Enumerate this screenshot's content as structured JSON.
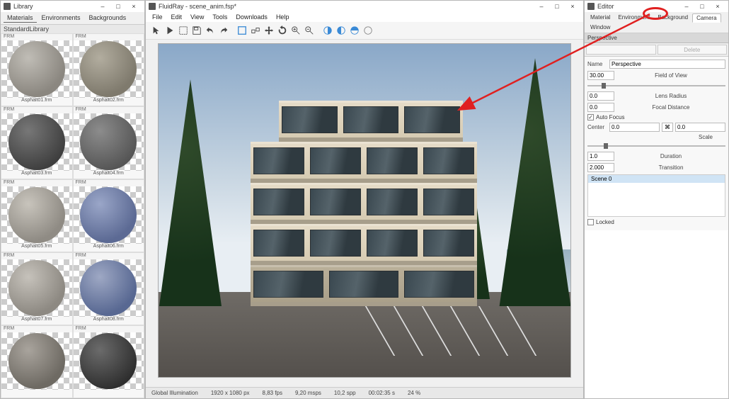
{
  "library": {
    "title": "Library",
    "tabs": [
      "Materials",
      "Environments",
      "Backgrounds"
    ],
    "active_tab": 0,
    "group": "StandardLibrary",
    "format_tag": "FRM",
    "materials": [
      {
        "name": "Asphalt01.frm",
        "ball_css": "radial-gradient(circle at 35% 30%, #c0bdb6, #8b8780 70%)"
      },
      {
        "name": "Asphalt02.frm",
        "ball_css": "radial-gradient(circle at 35% 30%, #b2ad9f, #7f7a6d 70%)"
      },
      {
        "name": "Asphalt03.frm",
        "ball_css": "radial-gradient(circle at 35% 30%, #777, #3e3e3e 75%)"
      },
      {
        "name": "Asphalt04.frm",
        "ball_css": "radial-gradient(circle at 35% 30%, #8c8c8c, #555 75%)"
      },
      {
        "name": "Asphalt05.frm",
        "ball_css": "radial-gradient(circle at 35% 30%, #c8c4bc, #8f8b84 70%)"
      },
      {
        "name": "Asphalt06.frm",
        "ball_css": "radial-gradient(circle at 35% 30%, #9aa6c8, #5c6a94 70%)"
      },
      {
        "name": "Asphalt07.frm",
        "ball_css": "radial-gradient(circle at 35% 30%, #c6c2bb, #8d8982 70%)"
      },
      {
        "name": "Asphalt08.frm",
        "ball_css": "radial-gradient(circle at 35% 30%, #9ea8c4, #586892 70%)"
      },
      {
        "name": "",
        "ball_css": "radial-gradient(circle at 35% 30%, #a9a49d, #6e6a63 70%)"
      },
      {
        "name": "",
        "ball_css": "radial-gradient(circle at 35% 30%, #6b6b6b, #2e2e2e 75%)"
      }
    ]
  },
  "main": {
    "title": "FluidRay - scene_anim.fsp*",
    "menu": [
      "File",
      "Edit",
      "View",
      "Tools",
      "Downloads",
      "Help"
    ],
    "status": {
      "mode": "Global Illumination",
      "res": "1920 x 1080 px",
      "fps": "8,83 fps",
      "msps": "9,20 msps",
      "spp": "10,2 spp",
      "time": "00:02:35 s",
      "pct": "24 %"
    }
  },
  "editor": {
    "title": "Editor",
    "tabs": [
      "Material",
      "Environment",
      "Background",
      "Camera",
      "Window"
    ],
    "active_tab": 3,
    "section_perspective": "Perspective",
    "buttons": {
      "delete": "Delete"
    },
    "name_label": "Name",
    "name_value": "Perspective",
    "fov": {
      "value": "30.00",
      "label": "Field of View"
    },
    "lens_radius": {
      "value": "0.0",
      "label": "Lens Radius"
    },
    "focal": {
      "value": "0.0",
      "label": "Focal Distance"
    },
    "autofocus": {
      "checked": true,
      "label": "Auto Focus"
    },
    "center": {
      "label": "Center",
      "value": "0.0"
    },
    "scale": {
      "label": "Scale",
      "value": "0.0",
      "lock": "⌘"
    },
    "duration": {
      "value": "1.0",
      "label": "Duration"
    },
    "transition": {
      "value": "2.000",
      "label": "Transition"
    },
    "scene_item": "Scene 0",
    "locked": {
      "checked": false,
      "label": "Locked"
    }
  }
}
